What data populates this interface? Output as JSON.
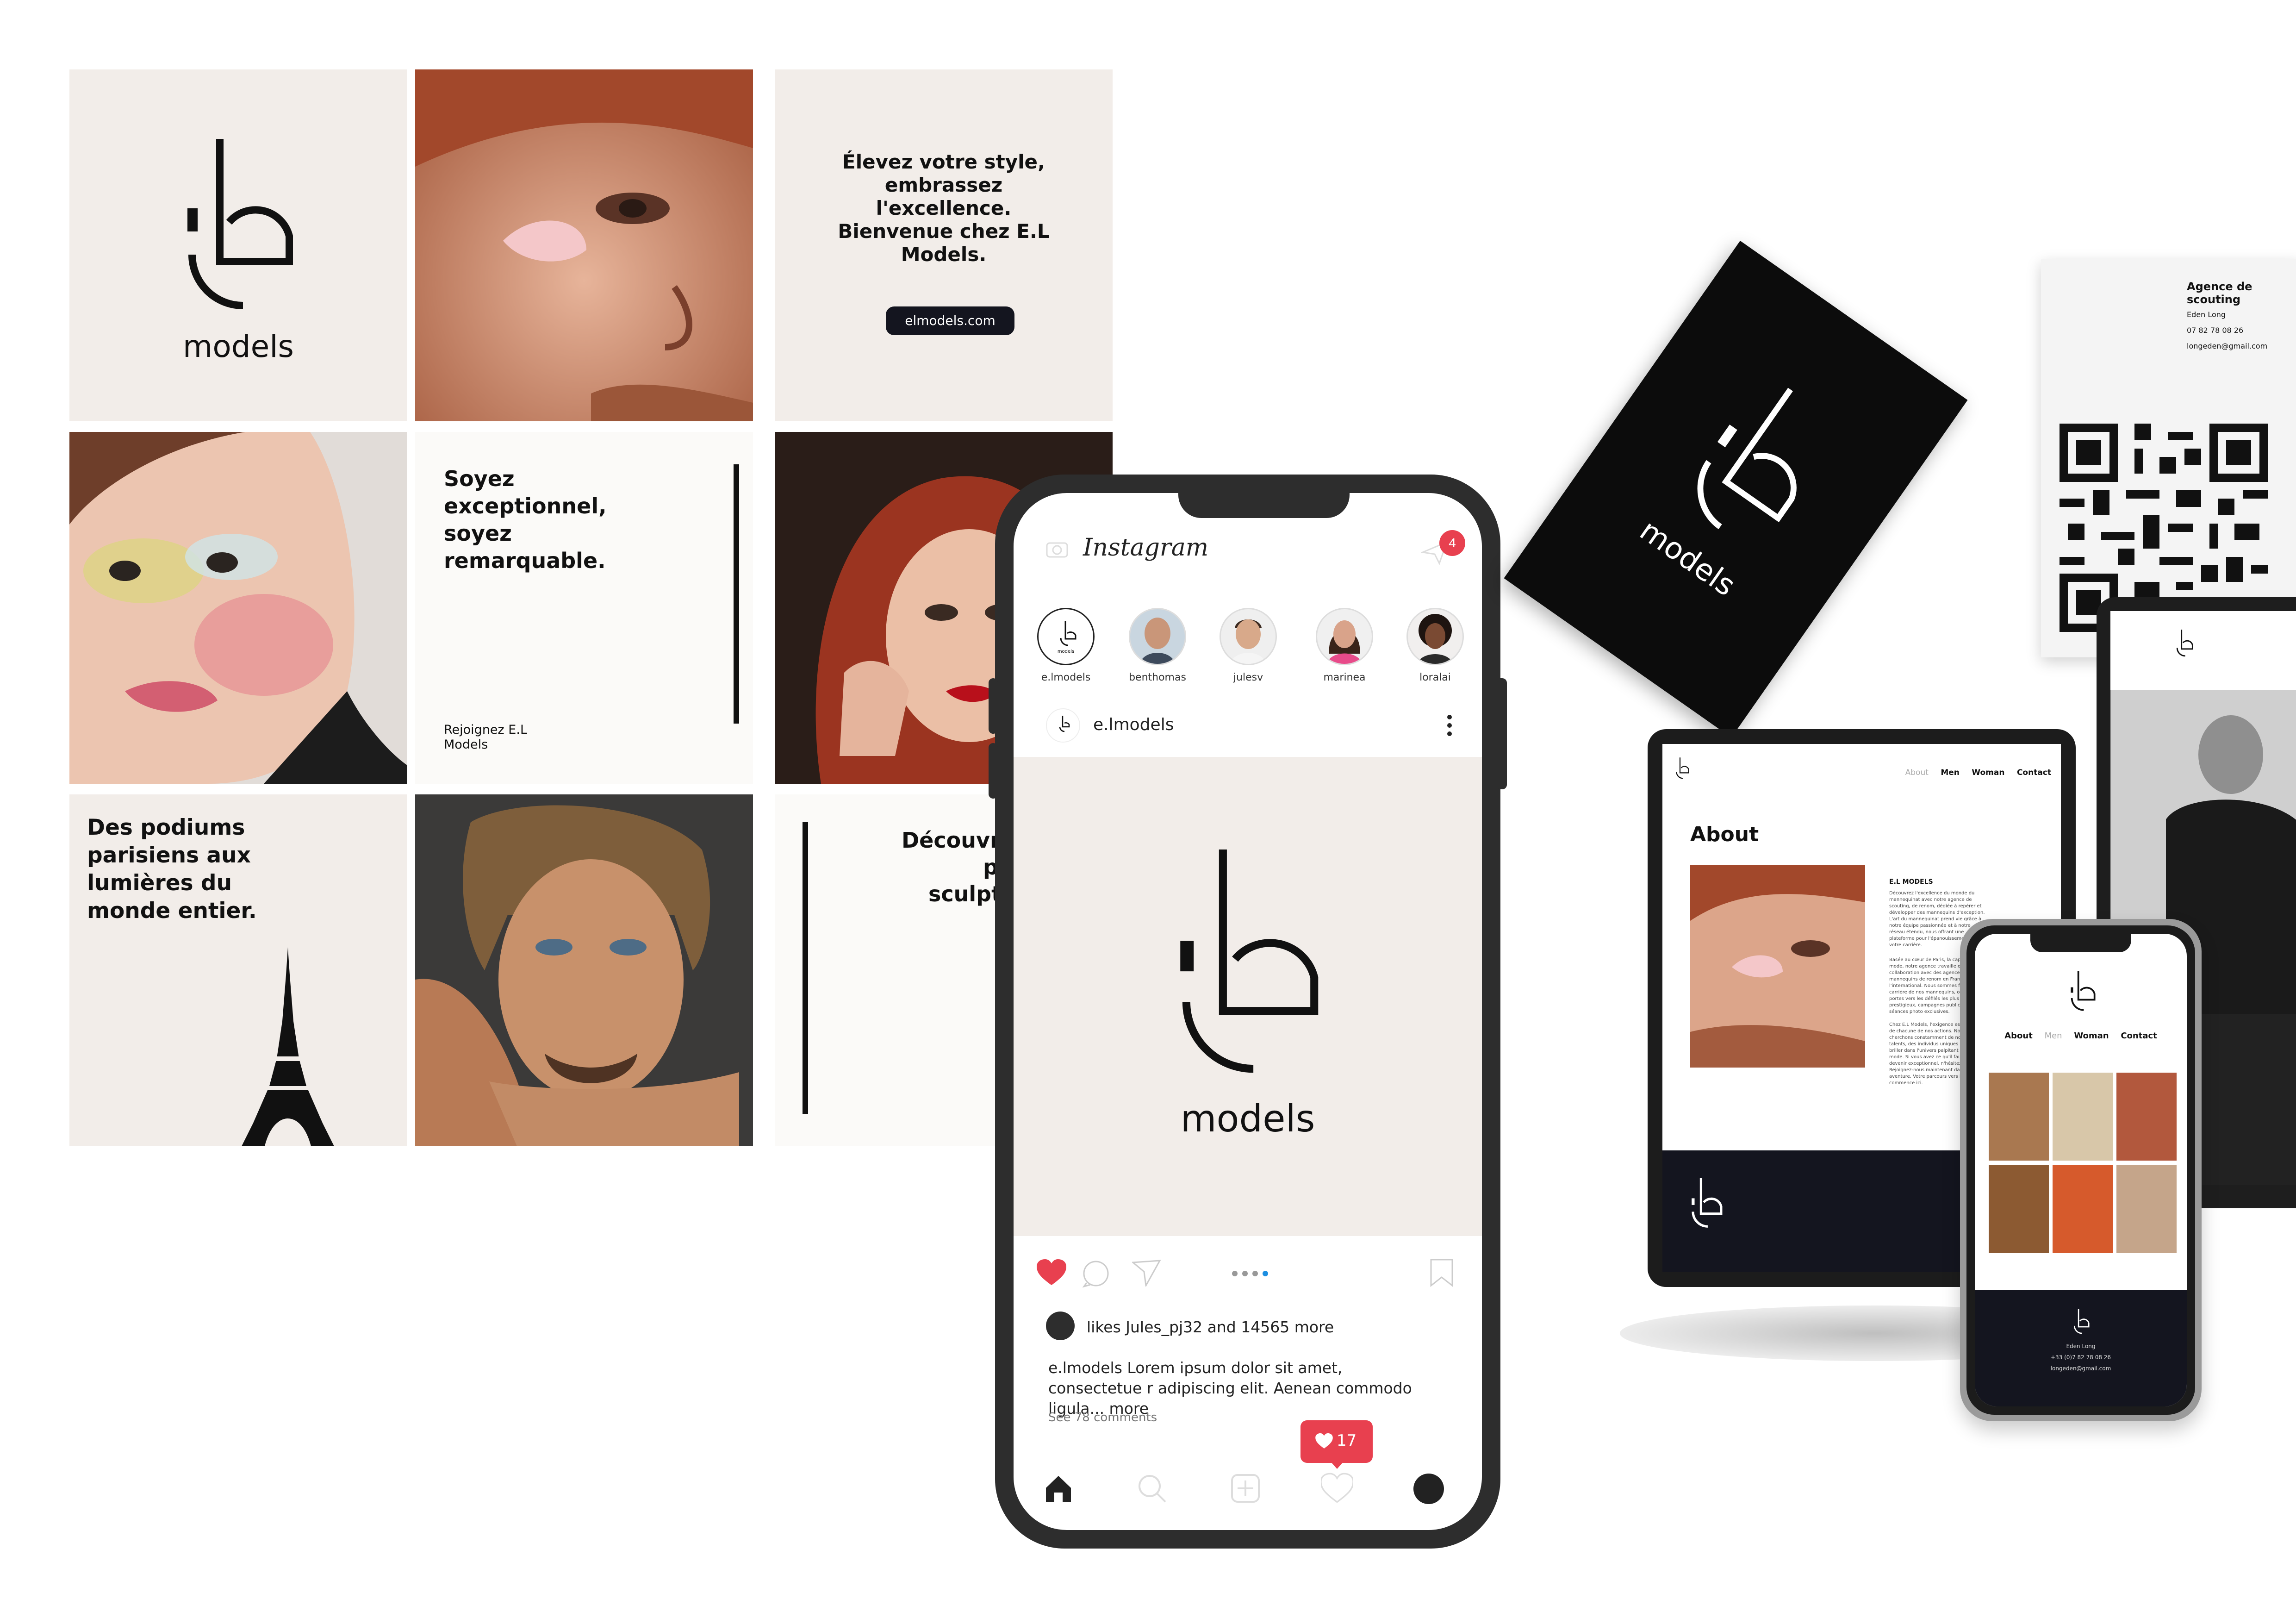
{
  "brand": {
    "logo_word": "models",
    "website": "elmodels.com"
  },
  "grid": {
    "tagline": "Élevez votre style, embrassez l'excellence. Bienvenue chez E.L Models.",
    "slogan": "Soyez exceptionnel, soyez remarquable.",
    "join": "Rejoignez E.L Models",
    "podiums": "Des podiums parisiens aux lumières du monde entier.",
    "discover_line1": "Découvr",
    "discover_line2": "p",
    "discover_line3": "sculpt"
  },
  "instagram": {
    "app_name": "Instagram",
    "notification_count": "4",
    "stories": [
      {
        "name": "e.lmodels"
      },
      {
        "name": "benthomas"
      },
      {
        "name": "julesv"
      },
      {
        "name": "marinea"
      },
      {
        "name": "loralai"
      }
    ],
    "post_author": "e.lmodels",
    "post_logo_word": "models",
    "likes_text": "likes Jules_pj32 and 14565 more",
    "caption": "e.lmodels Lorem ipsum dolor sit amet, consectetue r adipiscing elit. Aenean commodo ligula... more",
    "comments_link": "See 78 comments",
    "like_badge_count": "17"
  },
  "business_card": {
    "title": "Agence de scouting",
    "name": "Eden Long",
    "phone": "07 82 78 08 26",
    "email": "longeden@gmail.com",
    "logo_word": "models"
  },
  "website": {
    "nav": [
      "About",
      "Men",
      "Woman",
      "Contact"
    ],
    "about_heading": "About",
    "section_title": "E.L MODELS",
    "para1": "Découvrez l'excellence du monde du mannequinat avec notre agence de scouting, de renom, dédiée à repérer et développer des mannequins d'exception. L'art du mannequinat prend vie grâce à notre équipe passionnée et à notre réseau étendu, nous offrant une plateforme pour l'épanouissement de votre carrière.",
    "para2": "Basée au cœur de Paris, la capitale de la mode, notre agence travaille en étroite collaboration avec des agences de mannequins de renom en France et à l'international. Nous sommes fiers de la carrière de nos mannequins, ouvrant des portes vers les défilés les plus prestigieux, campagnes publicitaires et séances photo exclusives.",
    "para3": "Chez E.L Models, l'exigence est au centre de chacune de nos actions. Nous cherchons constamment de nouveaux talents, des individus uniques prêts à briller dans l'univers palpitant de la mode. Si vous avez ce qu'il faut pour devenir exceptionnel, n'hésitez plus. Rejoignez-nous maintenant dans notre aventure. Votre parcours vers le succès commence ici.",
    "footer_name": "Eden Long",
    "footer_phone": "+33 (0)7 82 78 08 26",
    "footer_email": "longeden@gmail.com"
  },
  "colors": {
    "tile_bg": "#f2ede9",
    "phone_frame": "#2d2d2d",
    "like_red": "#e8404f",
    "footer_dark": "#14151f"
  }
}
